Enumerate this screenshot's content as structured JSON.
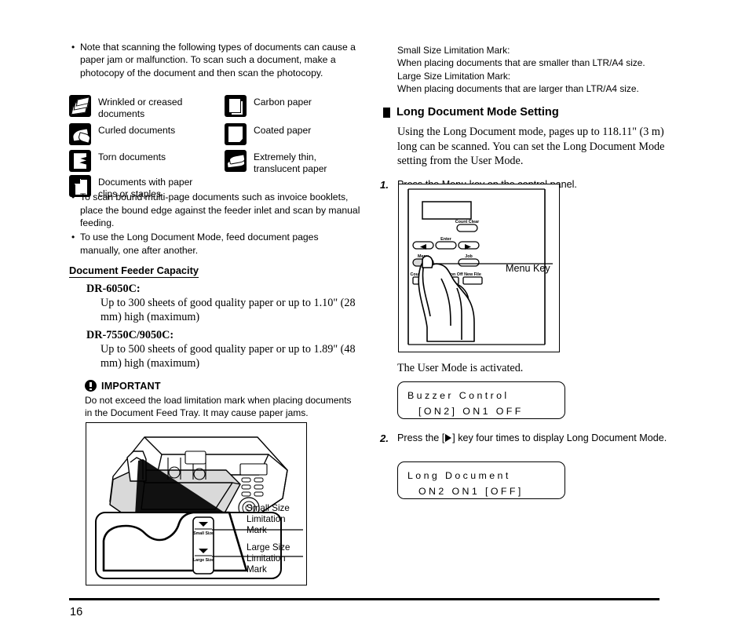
{
  "page": {
    "number": "16"
  },
  "left": {
    "intro_bullet": {
      "marker": "•",
      "text": "Note that scanning the following types of documents can cause a paper jam or malfunction. To scan such a document, make a photocopy of the document and then scan the photocopy."
    },
    "document_type_icons": [
      {
        "icon": "wrinkled-documents-icon",
        "label": "Wrinkled or creased documents"
      },
      {
        "icon": "curled-documents-icon",
        "label": "Curled documents"
      },
      {
        "icon": "torn-documents-icon",
        "label": "Torn documents"
      },
      {
        "icon": "paper-clips-staples-icon",
        "label": "Documents with paper clips or staples"
      },
      {
        "icon": "carbon-paper-icon",
        "label": "Carbon paper"
      },
      {
        "icon": "coated-paper-icon",
        "label": "Coated paper"
      },
      {
        "icon": "translucent-paper-icon",
        "label": "Extremely thin, translucent paper"
      }
    ],
    "bullets": [
      {
        "marker": "•",
        "text": "To scan bound multi-page documents such as invoice booklets, place the bound edge against the feeder inlet and scan by manual feeding."
      },
      {
        "marker": "•",
        "text": "To use the Long Document Mode, feed document pages manually, one after another."
      }
    ],
    "capacity_heading": "Document Feeder Capacity",
    "capacity_entries": [
      {
        "model": "DR-6050C:",
        "description": "Up to 300 sheets of good quality paper or up to 1.10\" (28 mm) high (maximum)"
      },
      {
        "model": "DR-7550C/9050C:",
        "description": "Up to 500 sheets of good quality paper or up to 1.89\" (48 mm) high (maximum)"
      }
    ],
    "important": {
      "icon": "exclamation-circle-icon",
      "title": "IMPORTANT",
      "body": "Do not exceed the load limitation mark when placing documents in the Document Feed Tray. It may cause paper jams."
    },
    "figure": {
      "name": "document-feed-tray-illustration",
      "tray_marks": [
        {
          "arrow": "▼",
          "text": "Small Size"
        },
        {
          "arrow": "▼",
          "text": "Large Size"
        }
      ],
      "callouts": [
        {
          "label": "Small Size\nLimitation\nMark",
          "lines": [
            "Small Size",
            "Limitation",
            "Mark"
          ]
        },
        {
          "label": "Large Size\nLimitation\nMark",
          "lines": [
            "Large Size",
            "Limitation",
            "Mark"
          ]
        }
      ]
    }
  },
  "right": {
    "mark_notes": [
      "Small Size Limitation Mark:",
      "When placing documents that are smaller than LTR/A4 size.",
      "Large Size Limitation Mark:",
      "When placing documents that are larger than LTR/A4 size."
    ],
    "section_heading": "Long Document Mode Setting",
    "section_intro": "Using the Long Document mode, pages up to 118.11\" (3 m) long can be scanned. You can set the Long Document Mode setting from the User Mode.",
    "step1": {
      "number": "1.",
      "text": "Press the Menu key on the control panel."
    },
    "panel_figure": {
      "name": "control-panel-illustration",
      "menu_key_callout": "Menu Key",
      "buttons": [
        "Count Clear",
        "Enter",
        "Menu",
        "Job",
        "Count Only",
        "Separation Off",
        "New File"
      ]
    },
    "after_step1_note": "The User Mode is activated.",
    "lcd1": {
      "line1": "Buzzer Control",
      "line2": "[ON2]  ON1   OFF"
    },
    "step2": {
      "number": "2.",
      "text_before": "Press the [",
      "text_after": "] key four times to display Long Document Mode."
    },
    "lcd2": {
      "line1": "Long Document",
      "line2": "ON2   ON1  [OFF]"
    }
  }
}
